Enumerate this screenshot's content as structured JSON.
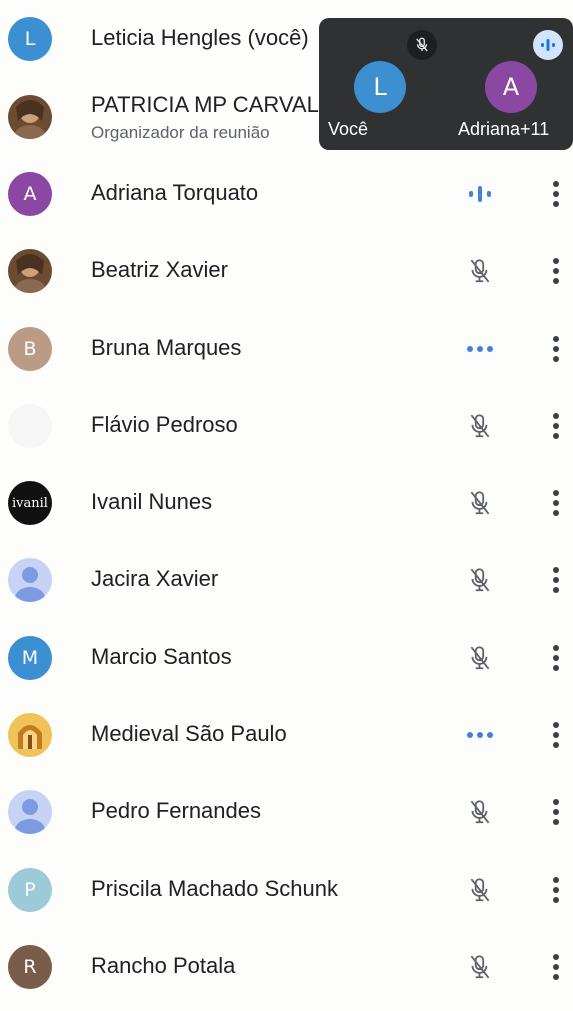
{
  "participants": [
    {
      "name": "Leticia Hengles (você)",
      "initial": "L",
      "avatar_color": "#3c8fd0",
      "status": "none"
    },
    {
      "name": "PATRICIA MP CARVALHO",
      "subtitle": "Organizador da reunião",
      "avatar_type": "photo",
      "status": "none"
    },
    {
      "name": "Adriana Torquato",
      "initial": "A",
      "avatar_color": "#8b48a2",
      "status": "speaking"
    },
    {
      "name": "Beatriz Xavier",
      "avatar_type": "photo",
      "status": "muted"
    },
    {
      "name": "Bruna Marques",
      "initial": "B",
      "avatar_color": "#b99b86",
      "status": "connecting"
    },
    {
      "name": "Flávio Pedroso",
      "avatar_type": "blank",
      "status": "muted"
    },
    {
      "name": "Ivanil Nunes",
      "avatar_text": "ivanil",
      "avatar_type": "text-logo",
      "status": "muted"
    },
    {
      "name": "Jacira Xavier",
      "avatar_type": "default",
      "status": "muted"
    },
    {
      "name": "Marcio Santos",
      "initial": "M",
      "avatar_color": "#3c8fd0",
      "status": "muted"
    },
    {
      "name": "Medieval São Paulo",
      "avatar_type": "logo",
      "status": "connecting"
    },
    {
      "name": "Pedro Fernandes",
      "avatar_type": "default",
      "status": "muted"
    },
    {
      "name": "Priscila Machado Schunk",
      "initial": "P",
      "avatar_color": "#9ccad8",
      "status": "muted"
    },
    {
      "name": "Rancho Potala",
      "initial": "R",
      "avatar_color": "#7a5c4b",
      "status": "muted"
    }
  ],
  "overlay": {
    "self_initial": "L",
    "self_label": "Você",
    "other_initial": "A",
    "other_label": "Adriana",
    "extra_count": "+11"
  },
  "colors": {
    "accent": "#4a7fd8",
    "muted_icon": "#5f6368",
    "overlay_bg": "#2f3133"
  }
}
